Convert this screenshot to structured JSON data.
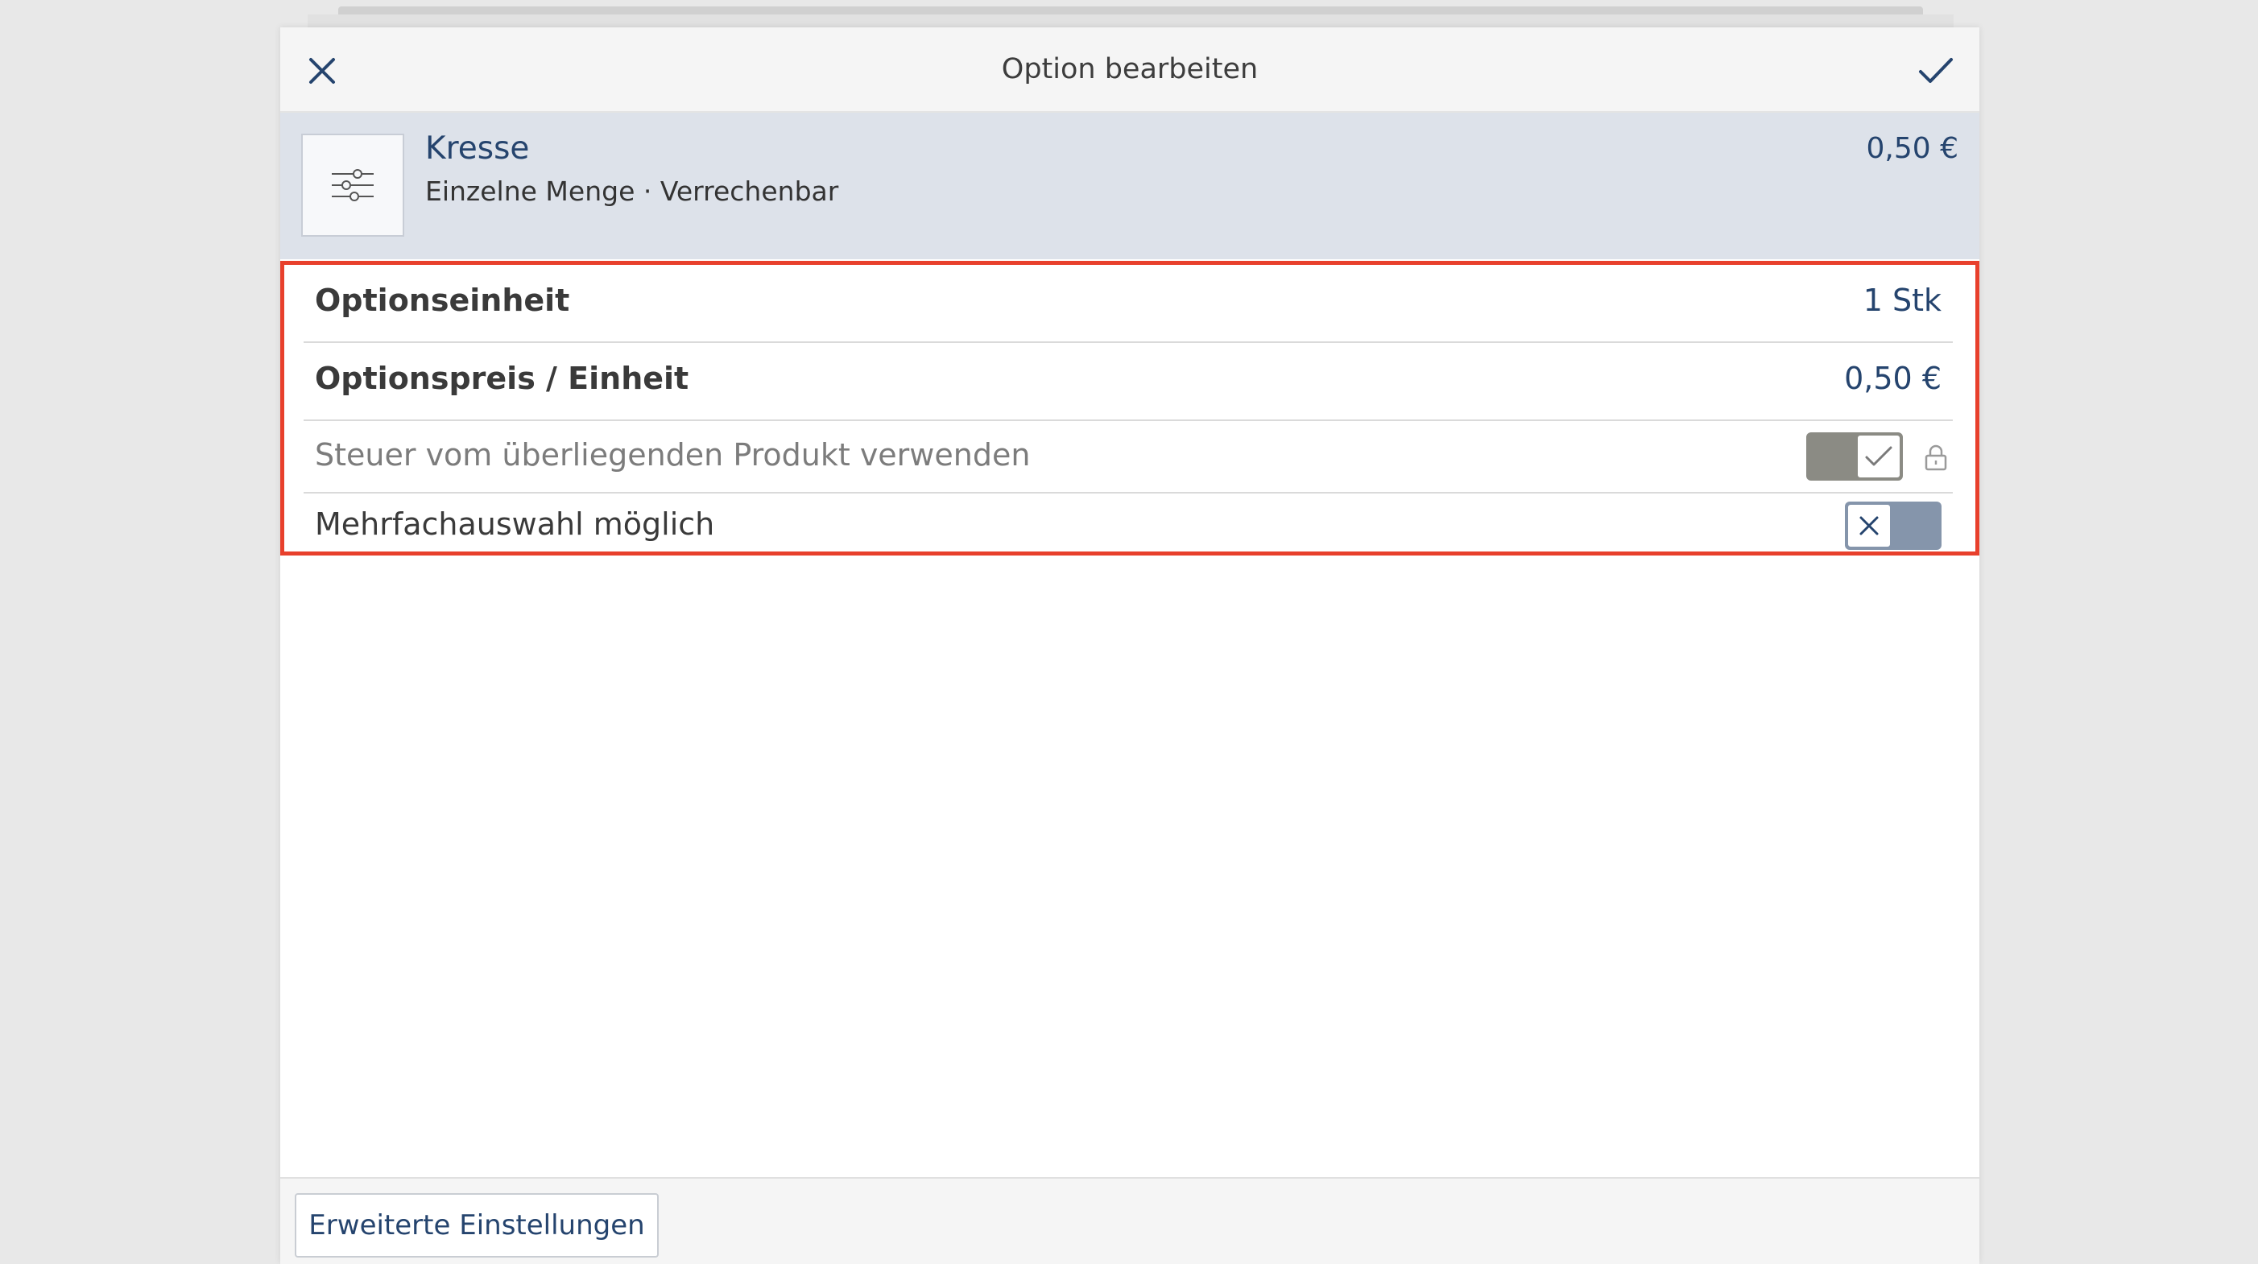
{
  "dialog": {
    "title": "Option bearbeiten",
    "close_icon": "close-icon",
    "confirm_icon": "checkmark-icon"
  },
  "product": {
    "icon": "sliders-icon",
    "name": "Kresse",
    "meta": "Einzelne Menge · Verrechenbar",
    "price": "0,50 €"
  },
  "settings": {
    "unit_label": "Optionseinheit",
    "unit_value": "1 Stk",
    "price_label": "Optionspreis / Einheit",
    "price_value": "0,50 €",
    "tax_label": "Steuer vom überliegenden Produkt verwenden",
    "tax_toggle": true,
    "tax_locked": true,
    "multi_label": "Mehrfachauswahl möglich",
    "multi_toggle": false
  },
  "footer": {
    "advanced_label": "Erweiterte Einstellungen"
  },
  "colors": {
    "accent": "#25446e",
    "highlight_border": "#e8402c",
    "toggle_on": "#8b8b84",
    "toggle_off": "#8595ab"
  }
}
